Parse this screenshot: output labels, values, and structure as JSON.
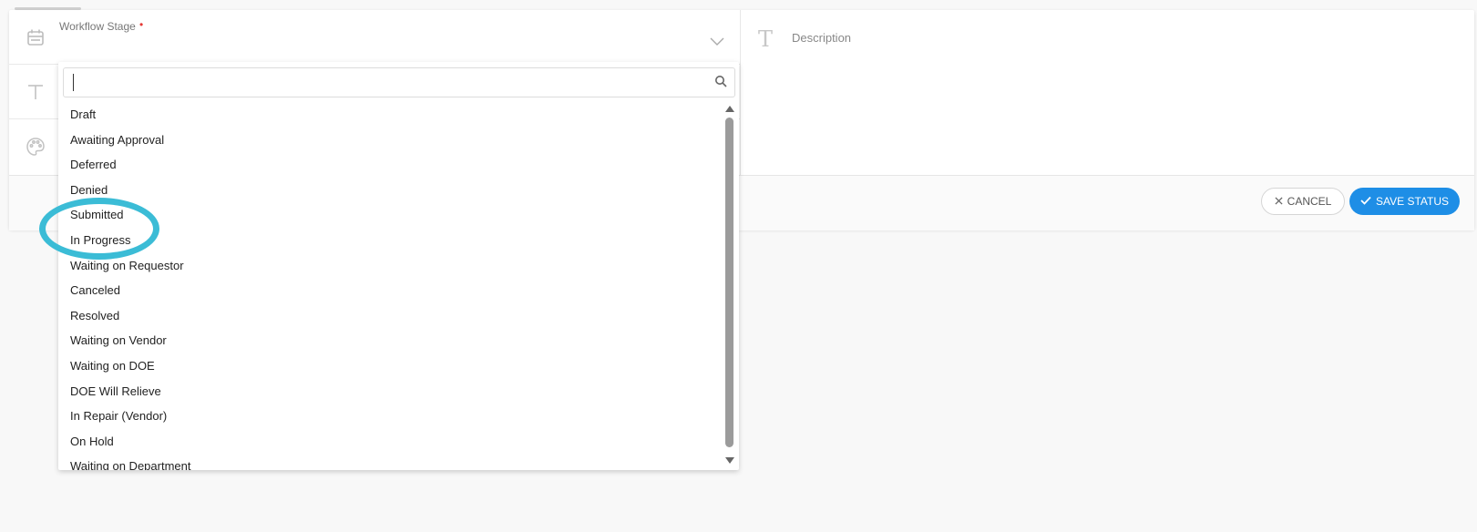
{
  "form": {
    "workflow_stage_label": "Workflow Stage",
    "required_marker": "•",
    "description_label": "Description"
  },
  "dropdown": {
    "search_value": "",
    "options": [
      "Draft",
      "Awaiting Approval",
      "Deferred",
      "Denied",
      "Submitted",
      "In Progress",
      "Waiting on Requestor",
      "Canceled",
      "Resolved",
      "Waiting on Vendor",
      "Waiting on DOE",
      "DOE Will Relieve",
      "In Repair (Vendor)",
      "On Hold",
      "Waiting on Department"
    ]
  },
  "footer": {
    "cancel_label": "CANCEL",
    "save_label": "SAVE STATUS"
  },
  "icons": {
    "stage": "calendar-icon",
    "text": "text-format-icon",
    "color": "palette-icon",
    "search": "search-icon",
    "expand": "chevron-down-icon",
    "cancel": "close-icon",
    "save": "check-icon"
  },
  "colors": {
    "primary": "#1e8ee6",
    "highlight": "#3bbcd6",
    "required": "#e53935"
  }
}
